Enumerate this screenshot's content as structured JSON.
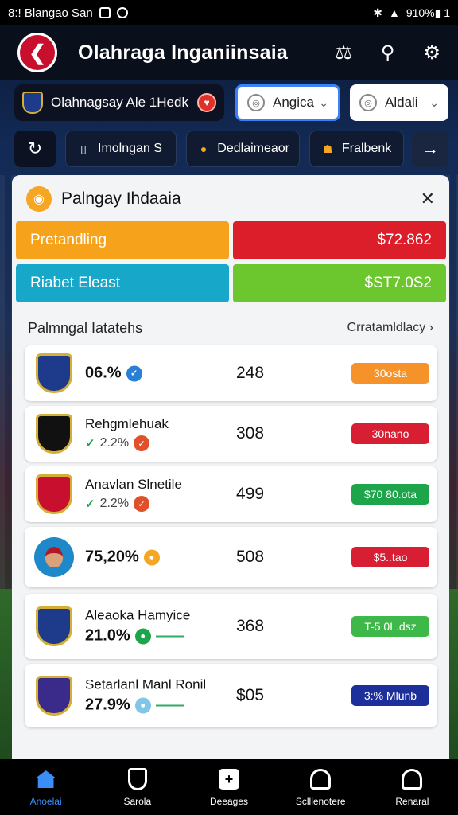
{
  "status": {
    "left": "8:! Blangao San",
    "right": "910%▮ 1"
  },
  "appbar": {
    "title": "Olahraga Inganiinsaia",
    "logo_glyph": "❮",
    "actions": [
      "filter-icon",
      "search-icon",
      "gear-icon"
    ]
  },
  "row1": {
    "team_chip": "Olahnagsay Ale 1Hedk",
    "dropdown1": "Angica",
    "dropdown2": "Aldali"
  },
  "row2": {
    "pills": [
      "Imolngan S",
      "Dedlaimeaor",
      "Fralbenk"
    ]
  },
  "card": {
    "title": "Palngay Ihdaaia",
    "stats": [
      {
        "label": "Pretandling",
        "value": "$72.862"
      },
      {
        "label": "Riabet Eleast",
        "value": "$ST7.0S2"
      }
    ],
    "section_title": "Palmngal Iatatehs",
    "section_link": "Crratamldlacy ›",
    "rows": [
      {
        "name": "",
        "pct": "06.%",
        "num": "248",
        "tag": "30osta",
        "tag_color": "#f5922a",
        "style": "crest",
        "crest": "#1e3a8a",
        "dot": "#2a7fd9",
        "dotg": "✓"
      },
      {
        "name": "Rehgmlehuak",
        "pct": "2.2%",
        "num": "308",
        "tag": "30nano",
        "tag_color": "#d71e32",
        "style": "crest-sub",
        "crest": "#111111",
        "dot": "#e0502a",
        "dotg": "✓"
      },
      {
        "name": "Anavlan Slnetile",
        "pct": "2.2%",
        "num": "499",
        "tag": "$70 80.ota",
        "tag_color": "#1ea44a",
        "style": "crest-sub",
        "crest": "#c8102e",
        "dot": "#e0502a",
        "dotg": "✓"
      },
      {
        "name": "",
        "pct": "75,20%",
        "num": "508",
        "tag": "$5..tao",
        "tag_color": "#d71e32",
        "style": "avatar",
        "crest": "#1e88c8",
        "dot": "#f5a623",
        "dotg": "●"
      },
      {
        "name": "Aleaoka Hamyice",
        "pct": "21.0%",
        "num": "368",
        "tag": "T-5 0L.dsz",
        "tag_color": "#3fb84a",
        "style": "crest-line",
        "crest": "#1e3a8a",
        "dot": "#1ea44a",
        "dotg": "●"
      },
      {
        "name": "Setarlanl Manl Ronil",
        "pct": "27.9%",
        "num": "$05",
        "tag": "3:% Mlunb",
        "tag_color": "#1c2f9a",
        "style": "crest-line",
        "crest": "#3a2a8a",
        "dot": "#7fc6e8",
        "dotg": "●"
      }
    ]
  },
  "bottomnav": [
    {
      "label": "Anoelai",
      "icon": "home-icon",
      "active": true
    },
    {
      "label": "Sarola",
      "icon": "shield-icon",
      "active": false
    },
    {
      "label": "Deeages",
      "icon": "plus-square-icon",
      "active": false
    },
    {
      "label": "Sclllenotere",
      "icon": "user-icon",
      "active": false
    },
    {
      "label": "Renaral",
      "icon": "profile-icon",
      "active": false
    }
  ],
  "colors": {
    "accent": "#3b8ef6",
    "brand_red": "#c8102e",
    "appbar_bg": "#0a0f1c"
  }
}
